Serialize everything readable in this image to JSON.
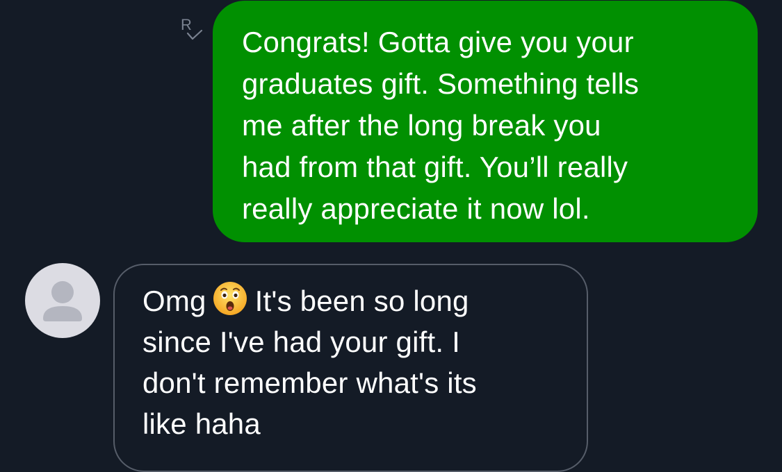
{
  "conversation": {
    "outgoing": {
      "read_receipt_letter": "R",
      "lines": [
        "Congrats! Gotta give you your",
        "graduates gift. Something tells",
        "me after the long break you",
        "had from that gift. You’ll really",
        "really appreciate it now lol."
      ]
    },
    "incoming": {
      "avatar_icon": "person-silhouette-icon",
      "emoji_icon": "astonished-face-emoji",
      "line1_before_emoji": "Omg",
      "line1_after_emoji": "It's been so long",
      "lines_rest": [
        "since I've had your gift. I",
        "don't remember what's its",
        "like haha"
      ]
    }
  },
  "colors": {
    "background": "#141b26",
    "outgoing_bubble": "#019001",
    "incoming_bubble_border": "#565d69",
    "avatar_bg": "#dcdce3",
    "avatar_figure": "#b4b6c0",
    "read_receipt": "#7a8290"
  }
}
